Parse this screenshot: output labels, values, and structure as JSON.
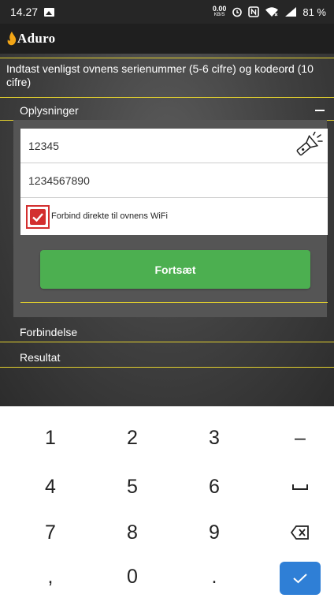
{
  "status_bar": {
    "time": "14.27",
    "speed_value": "0.00",
    "speed_unit": "KB/S",
    "battery": "81 %",
    "icons": [
      "image-icon",
      "alarm-icon",
      "nfc-icon",
      "wifi-icon",
      "signal-icon",
      "battery-icon"
    ]
  },
  "app_bar": {
    "logo_text": "Aduro"
  },
  "intro_text": "Indtast venligst ovnens serienummer (5-6 cifre) og kodeord (10 cifre)",
  "sections": {
    "info": "Oplysninger",
    "connection": "Forbindelse",
    "result": "Resultat"
  },
  "form": {
    "serial_value": "12345",
    "password_value": "1234567890",
    "wifi_checkbox_label": "Forbind direkte til ovnens WiFi",
    "wifi_checked": true,
    "continue_label": "Fortsæt"
  },
  "keyboard": {
    "keys": [
      "1",
      "2",
      "3",
      "–",
      "4",
      "5",
      "6",
      "space",
      "7",
      "8",
      "9",
      "backspace",
      ",",
      "0",
      ".",
      "enter"
    ],
    "labels": {
      "k1": "1",
      "k2": "2",
      "k3": "3",
      "dash": "–",
      "k4": "4",
      "k5": "5",
      "k6": "6",
      "k7": "7",
      "k8": "8",
      "k9": "9",
      "comma": ",",
      "k0": "0",
      "period": "."
    }
  },
  "colors": {
    "accent_yellow": "#e2d02e",
    "button_green": "#4caf50",
    "checkbox_red": "#d32f2f",
    "enter_blue": "#2f7fd6"
  }
}
